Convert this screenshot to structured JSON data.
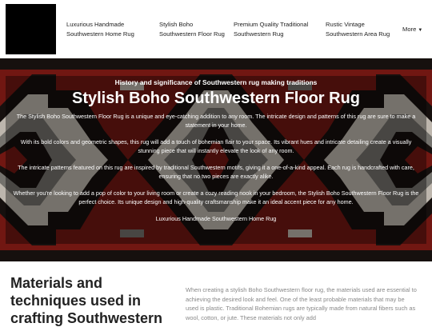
{
  "nav": {
    "items": [
      {
        "line1": "Luxurious Handmade",
        "line2": "Southwestern Home Rug"
      },
      {
        "line1": "Stylish Boho",
        "line2": "Southwestern Floor Rug"
      },
      {
        "line1": "Premium Quality Traditional",
        "line2": "Southwestern Rug"
      },
      {
        "line1": "Rustic Vintage",
        "line2": "Southwestern Area Rug"
      }
    ],
    "more_label": "More",
    "more_icon": "chevron-down-icon"
  },
  "hero": {
    "kicker": "History and significance of Southwestern rug making traditions",
    "title": "Stylish Boho Southwestern Floor Rug",
    "paragraphs": [
      "The Stylish Boho Southwestern Floor Rug is a unique and eye-catching addition to any room. The intricate design and patterns of this rug are sure to make a statement in your home.",
      "With its bold colors and geometric shapes, this rug will add a touch of bohemian flair to your space. Its vibrant hues and intricate detailing create a visually stunning piece that will instantly elevate the look of any room.",
      "The intricate patterns featured on this rug are inspired by traditional Southwestern motifs, giving it a one-of-a-kind appeal. Each rug is handcrafted with care, ensuring that no two pieces are exactly alike.",
      "Whether you're looking to add a pop of color to your living room or create a cozy reading nook in your bedroom, the Stylish Boho Southwestern Floor Rug is the perfect choice. Its unique design and high-quality craftsmanship make it an ideal accent piece for any home."
    ],
    "link": "Luxurious Handmade Southwestern Home Rug"
  },
  "section": {
    "title": "Materials and techniques used in crafting Southwestern",
    "body": "When creating a stylish Boho Southwestern floor rug, the materials used are essential to achieving the desired look and feel. One of the least probable materials that may be used is plastic. Traditional Bohemian rugs are typically made from natural fibers such as wool, cotton, or jute. These materials not only add"
  },
  "colors": {
    "rug_red": "#8a1d16",
    "rug_dark": "#1c1412",
    "rug_cream": "#e7dfd3",
    "rug_grey": "#8e8c86"
  }
}
